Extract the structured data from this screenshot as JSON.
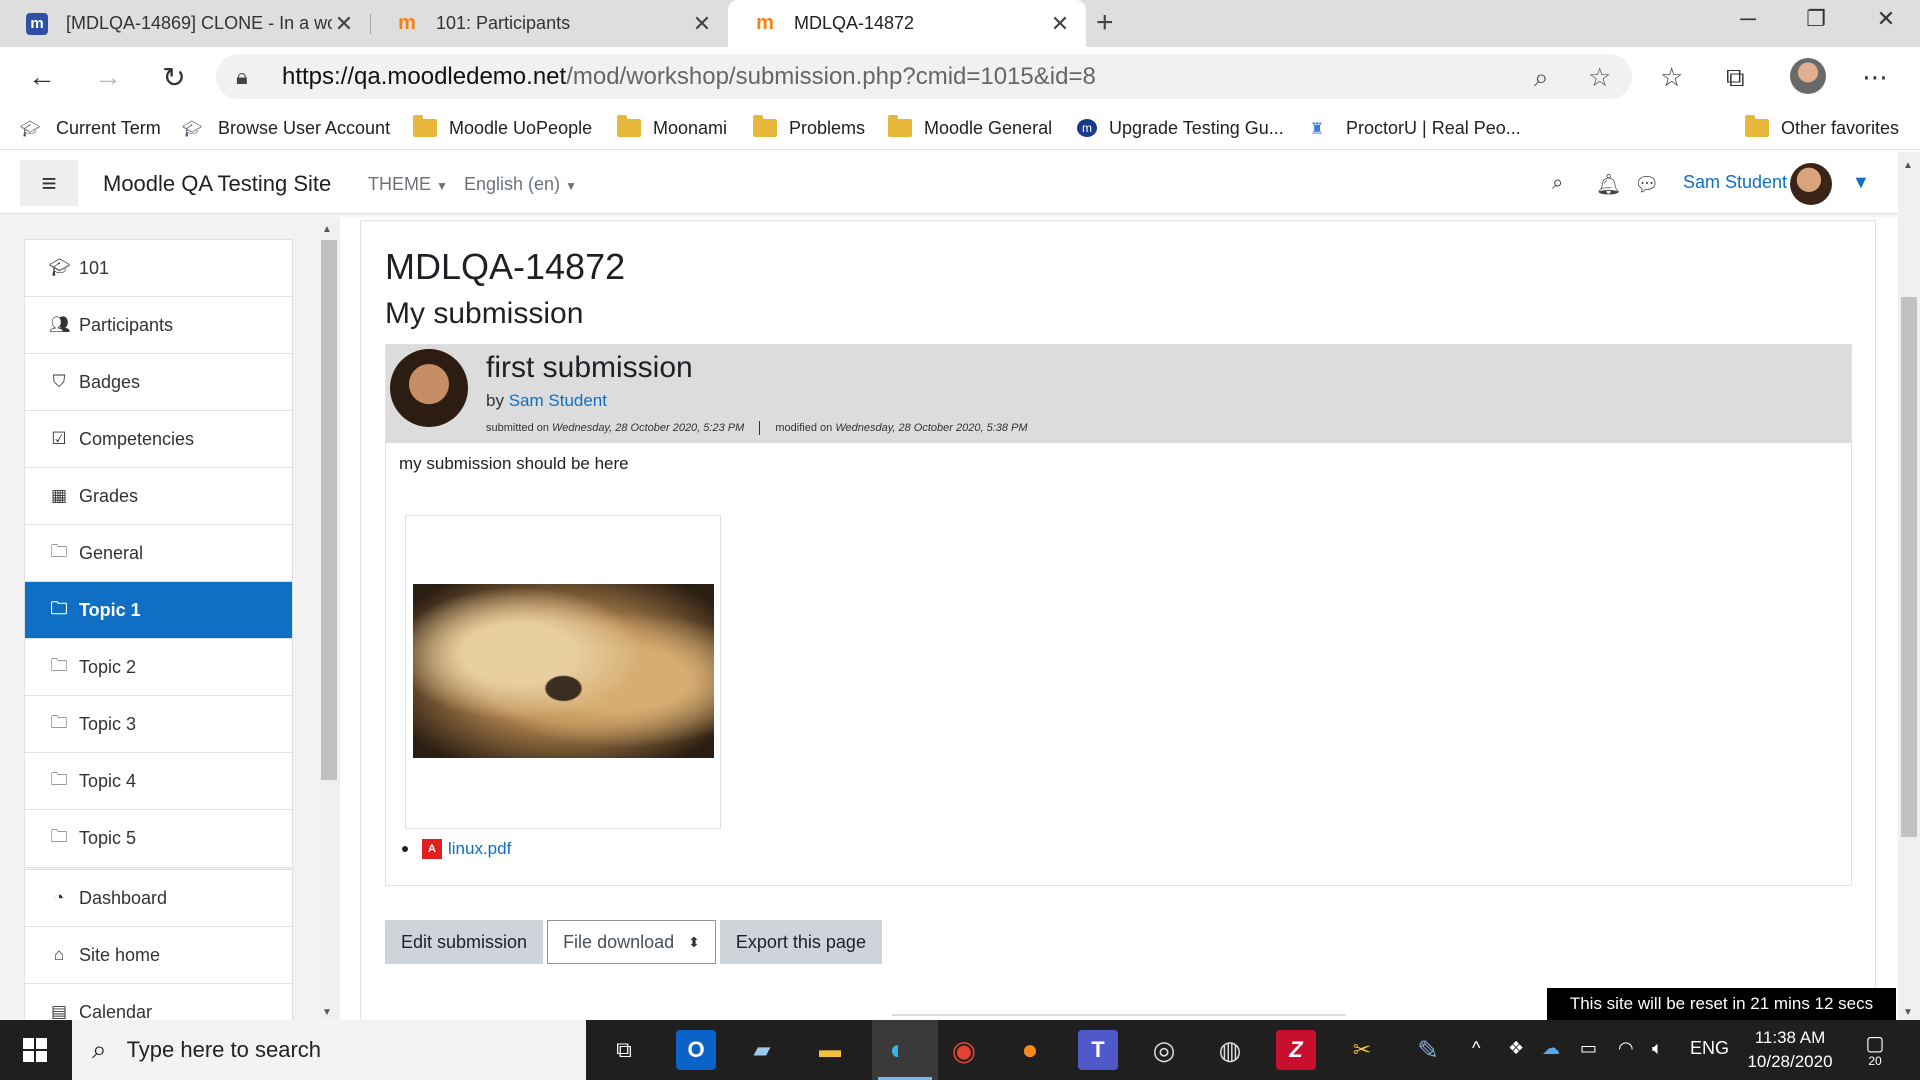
{
  "browser": {
    "tabs": [
      {
        "title": "[MDLQA-14869] CLONE - In a workshop",
        "active": false
      },
      {
        "title": "101: Participants",
        "active": false
      },
      {
        "title": "MDLQA-14872",
        "active": true
      }
    ],
    "url_host": "https://qa.moodledemo.net",
    "url_path": "/mod/workshop/submission.php?cmid=1015&id=8",
    "favorites": [
      "Current Term",
      "Browse User Account",
      "Moodle UoPeople",
      "Moonami",
      "Problems",
      "Moodle General",
      "Upgrade Testing Gu...",
      "ProctorU | Real Peo..."
    ],
    "other_favorites": "Other favorites"
  },
  "moodle_nav": {
    "site_name": "Moodle QA Testing Site",
    "theme_label": "THEME",
    "language_label": "English (en)",
    "user_name": "Sam Student"
  },
  "drawer": {
    "items": [
      {
        "label": "101",
        "icon": "graduation-cap-icon",
        "active": false
      },
      {
        "label": "Participants",
        "icon": "users-icon",
        "active": false
      },
      {
        "label": "Badges",
        "icon": "shield-icon",
        "active": false
      },
      {
        "label": "Competencies",
        "icon": "check-square-icon",
        "active": false
      },
      {
        "label": "Grades",
        "icon": "table-icon",
        "active": false
      },
      {
        "label": "General",
        "icon": "folder-icon",
        "active": false
      },
      {
        "label": "Topic 1",
        "icon": "folder-icon",
        "active": true
      },
      {
        "label": "Topic 2",
        "icon": "folder-icon",
        "active": false
      },
      {
        "label": "Topic 3",
        "icon": "folder-icon",
        "active": false
      },
      {
        "label": "Topic 4",
        "icon": "folder-icon",
        "active": false
      },
      {
        "label": "Topic 5",
        "icon": "folder-icon",
        "active": false
      }
    ],
    "items2": [
      {
        "label": "Dashboard",
        "icon": "tachometer-icon"
      },
      {
        "label": "Site home",
        "icon": "home-icon"
      },
      {
        "label": "Calendar",
        "icon": "calendar-icon"
      }
    ]
  },
  "main": {
    "course_heading": "MDLQA-14872",
    "sub_heading": "My submission",
    "submission": {
      "title": "first submission",
      "by_prefix": "by",
      "author": "Sam Student",
      "submitted_prefix": "submitted on",
      "submitted_on": "Wednesday, 28 October 2020, 5:23 PM",
      "modified_prefix": "modified on",
      "modified_on": "Wednesday, 28 October 2020, 5:38 PM",
      "content": "my submission should be here",
      "attachment": "linux.pdf"
    },
    "buttons": {
      "edit": "Edit submission",
      "download_select": "File download",
      "export": "Export this page"
    },
    "reset_notice": "This site will be reset in 21 mins 12 secs"
  },
  "taskbar": {
    "search_placeholder": "Type here to search",
    "language": "ENG",
    "time": "11:38 AM",
    "date": "10/28/2020",
    "notifications": "20"
  },
  "colors": {
    "moodle_blue": "#0f6fc5",
    "header_grey": "#dcdcdc"
  }
}
